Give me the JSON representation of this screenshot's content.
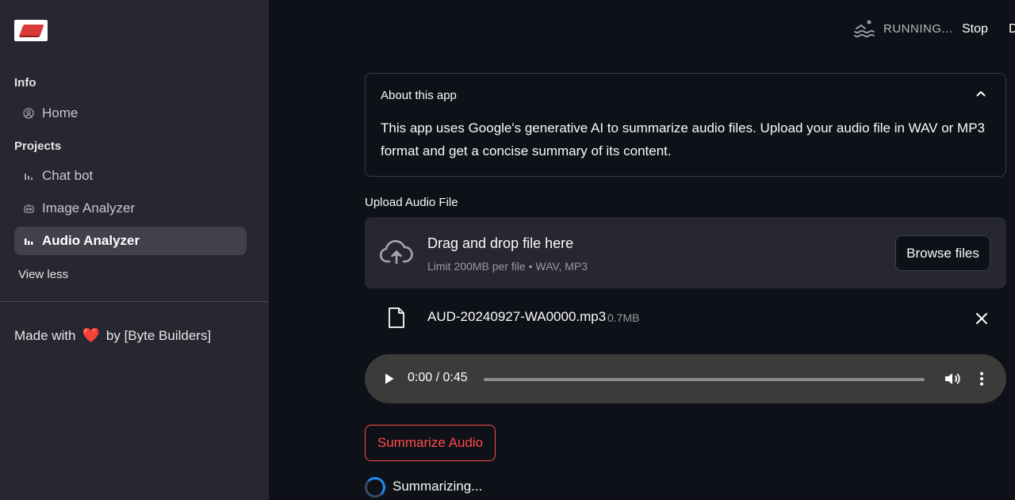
{
  "sidebar": {
    "sections": [
      {
        "label": "Info",
        "items": [
          {
            "label": "Home",
            "icon": "user-circle-icon",
            "active": false
          }
        ]
      },
      {
        "label": "Projects",
        "items": [
          {
            "label": "Chat bot",
            "icon": "bar-chart-icon",
            "active": false
          },
          {
            "label": "Image Analyzer",
            "icon": "robot-icon",
            "active": false
          },
          {
            "label": "Audio Analyzer",
            "icon": "bar-chart-icon",
            "active": true
          }
        ]
      }
    ],
    "view_less": "View less",
    "footer": {
      "prefix": "Made with",
      "heart": "❤️",
      "suffix": "by [Byte Builders]"
    }
  },
  "header": {
    "status": "RUNNING...",
    "stop": "Stop",
    "deploy": "D"
  },
  "expander": {
    "title": "About this app",
    "body": "This app uses Google's generative AI to summarize audio files. Upload your audio file in WAV or MP3 format and get a concise summary of its content."
  },
  "uploader": {
    "label": "Upload Audio File",
    "drop_title": "Drag and drop file here",
    "drop_sub": "Limit 200MB per file • WAV, MP3",
    "browse": "Browse files",
    "file": {
      "name": "AUD-20240927-WA0000.mp3",
      "size": "0.7MB"
    }
  },
  "audio": {
    "time": "0:00 / 0:45",
    "progress_fraction": 0
  },
  "summarize_button": "Summarize Audio",
  "status_text": "Summarizing...",
  "colors": {
    "accent": "#ff4b4b",
    "background": "#0e1117",
    "sidebar": "#262730",
    "spinner": "#1f8ef1"
  }
}
